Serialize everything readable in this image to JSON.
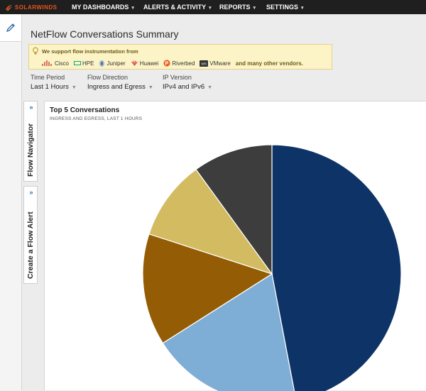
{
  "app": {
    "brand": "SOLARWINDS"
  },
  "nav": {
    "items": [
      {
        "label": "MY DASHBOARDS"
      },
      {
        "label": "ALERTS & ACTIVITY"
      },
      {
        "label": "REPORTS"
      },
      {
        "label": "SETTINGS"
      }
    ]
  },
  "page": {
    "title": "NetFlow Conversations Summary"
  },
  "notice": {
    "title": "We support flow instrumentation from",
    "vendors": [
      {
        "name": "Cisco",
        "icon": "cisco-icon"
      },
      {
        "name": "HPE",
        "icon": "hpe-icon"
      },
      {
        "name": "Juniper",
        "icon": "juniper-icon"
      },
      {
        "name": "Huawei",
        "icon": "huawei-icon"
      },
      {
        "name": "Riverbed",
        "icon": "riverbed-icon"
      },
      {
        "name": "VMware",
        "icon": "vmware-icon"
      }
    ],
    "more": "and many other vendors."
  },
  "filters": {
    "time_period": {
      "label": "Time Period",
      "value": "Last 1 Hours"
    },
    "flow_direction": {
      "label": "Flow Direction",
      "value": "Ingress and Egress"
    },
    "ip_version": {
      "label": "IP Version",
      "value": "IPv4 and IPv6"
    }
  },
  "sidetabs": {
    "flow_navigator": {
      "label": "Flow Navigator",
      "chevron": "»"
    },
    "create_alert": {
      "label": "Create a Flow Alert",
      "chevron": "»"
    }
  },
  "widget": {
    "title": "Top 5 Conversations",
    "subtitle": "INGRESS AND EGRESS, LAST 1 HOURS"
  },
  "chart_data": {
    "type": "pie",
    "slices": [
      {
        "value": 47,
        "color": "#0e3366"
      },
      {
        "value": 19,
        "color": "#7eadd6"
      },
      {
        "value": 14,
        "color": "#945c04"
      },
      {
        "value": 10,
        "color": "#d2bb61"
      },
      {
        "value": 10,
        "color": "#3d3d3d"
      }
    ]
  }
}
